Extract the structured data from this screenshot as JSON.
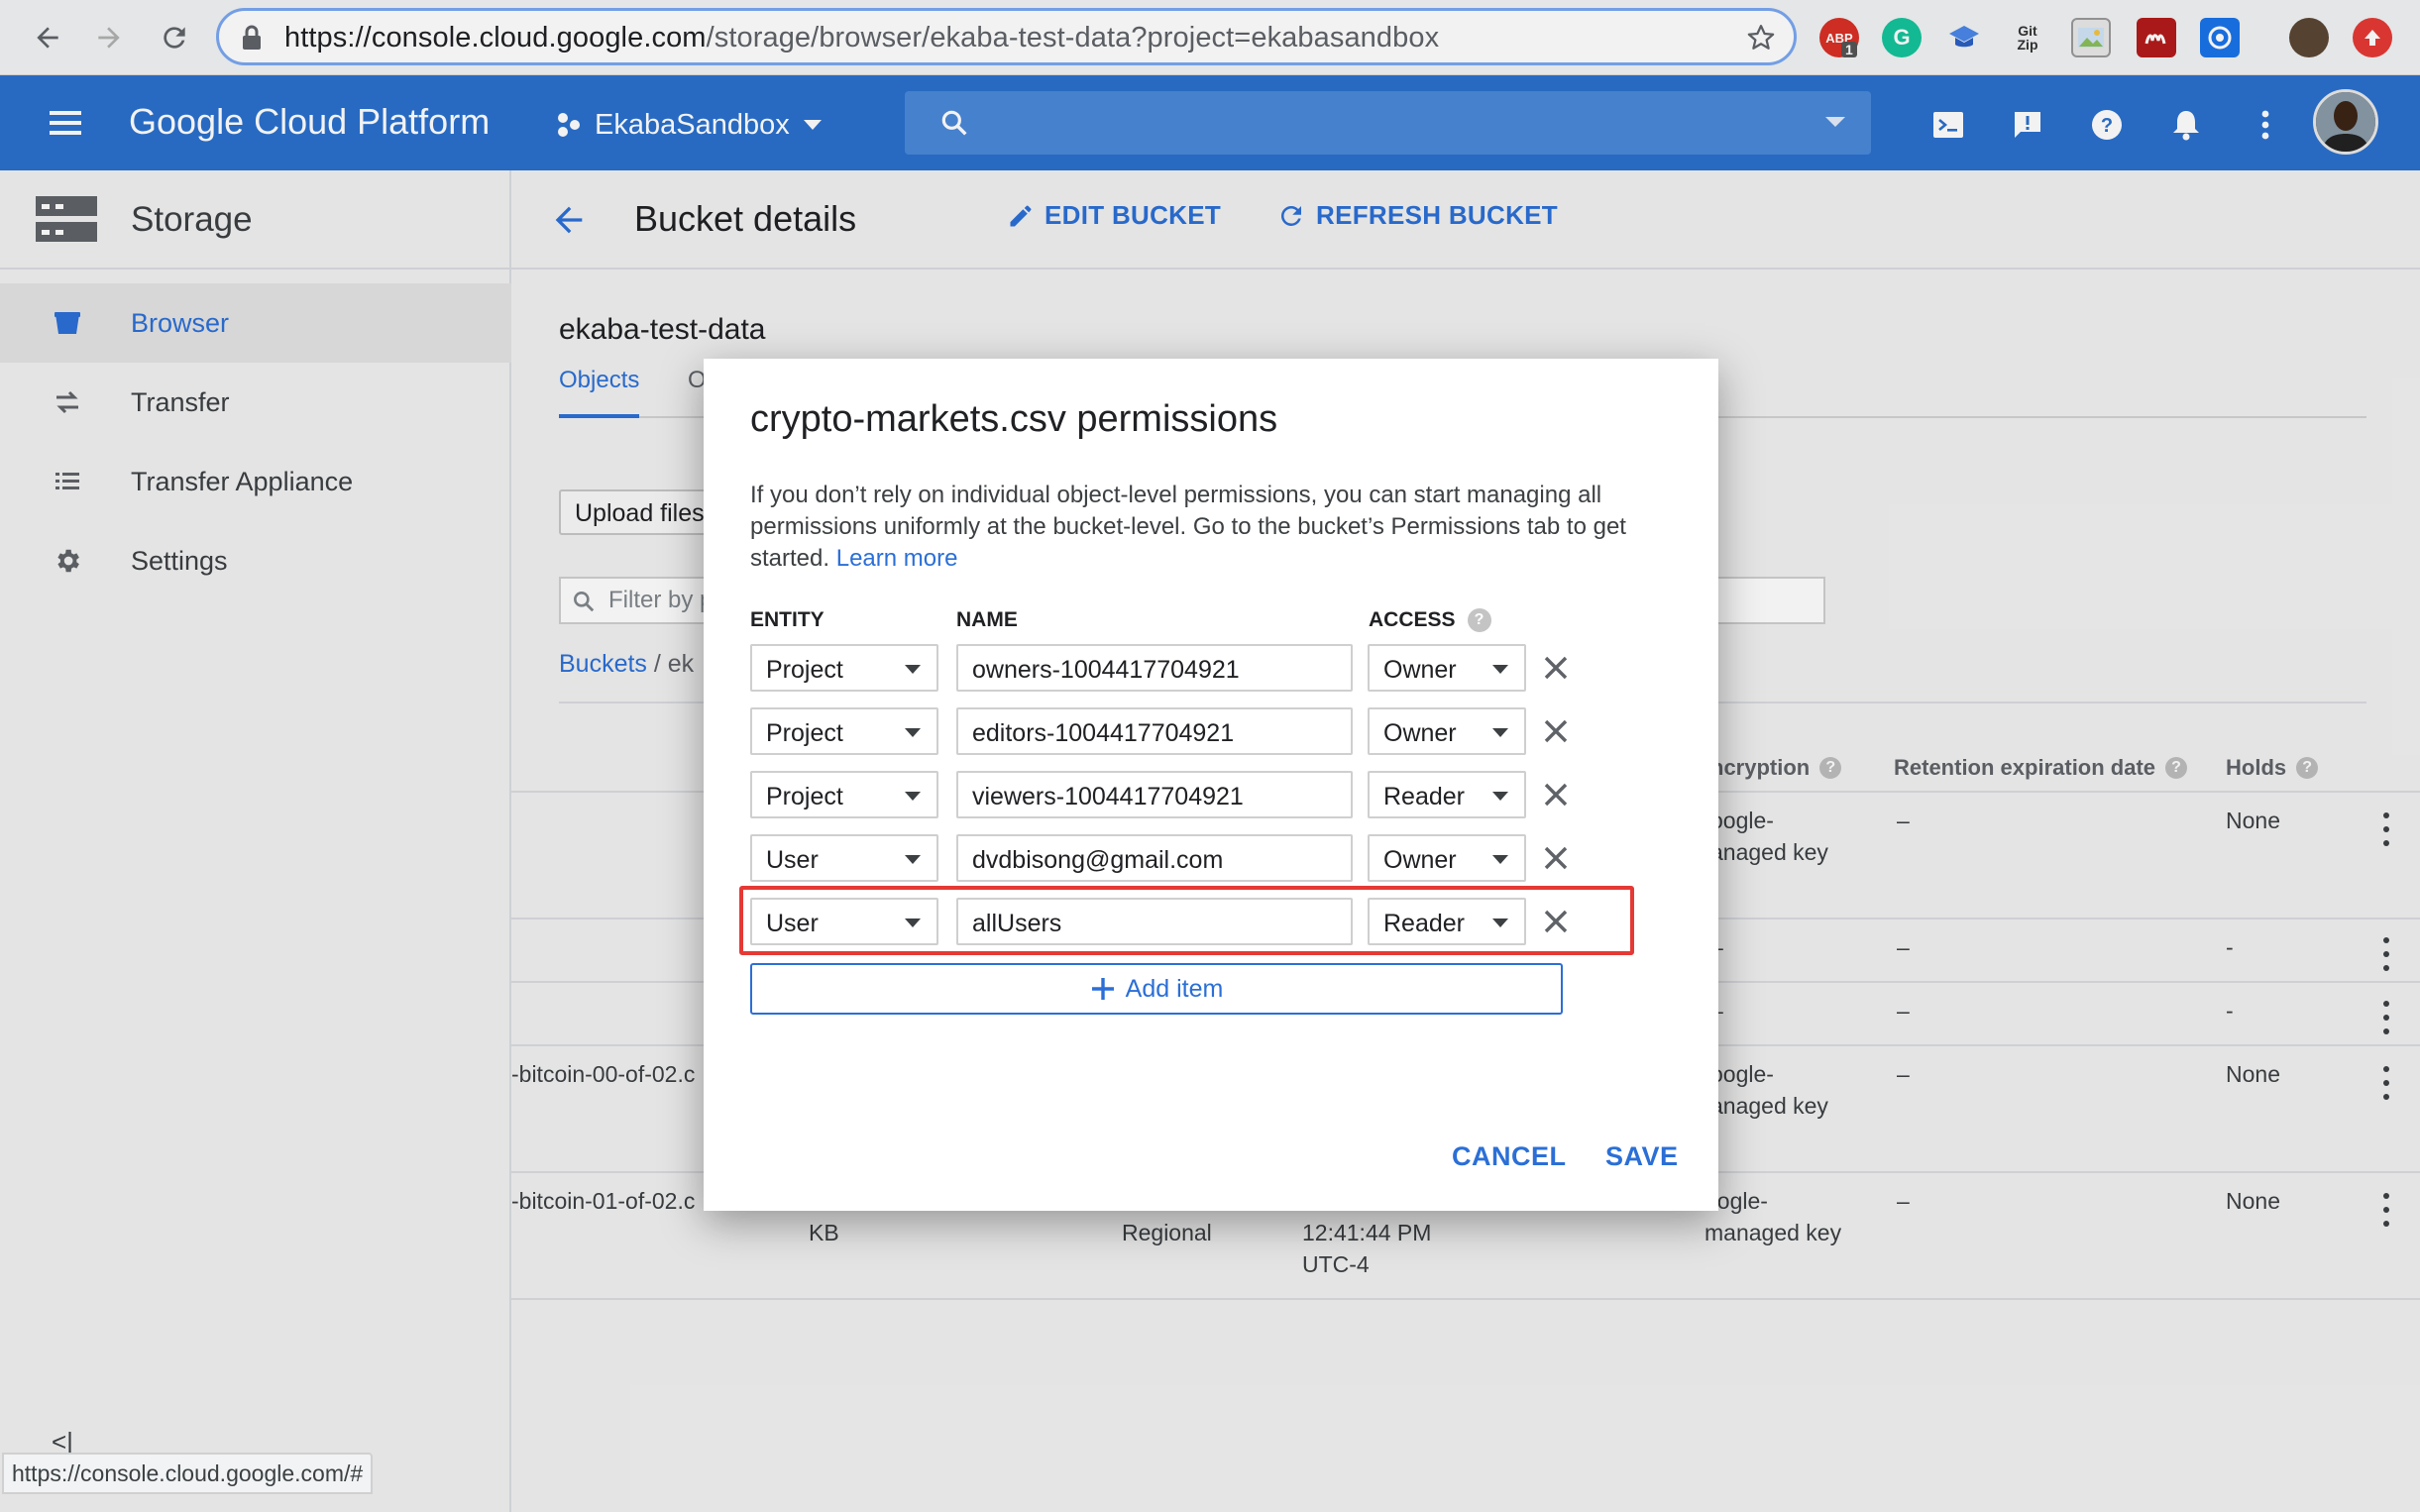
{
  "browser": {
    "url_main": "https://console.cloud.google.com",
    "url_path": "/storage/browser/ekaba-test-data?project=ekabasandbox",
    "extensions": [
      {
        "name": "adblock-icon",
        "label": "ABP",
        "badge": "1",
        "color": "#d93025"
      },
      {
        "name": "grammarly-icon",
        "label": "G",
        "color": "#15c39a"
      },
      {
        "name": "graduation-cap-icon",
        "label": "",
        "color": "#4a86e8"
      },
      {
        "name": "gitzip-icon",
        "label": "Git Zip",
        "color": "#ffffff"
      },
      {
        "name": "image-icon",
        "label": "",
        "color": "#e0e0e0"
      },
      {
        "name": "mendeley-icon",
        "label": "",
        "color": "#b31b1b"
      },
      {
        "name": "target-icon",
        "label": "",
        "color": "#1a73e8"
      },
      {
        "name": "profile-icon",
        "label": "",
        "color": "#5b4634"
      },
      {
        "name": "upload-icon",
        "label": "",
        "color": "#e53935"
      }
    ]
  },
  "gcp": {
    "title": "Google Cloud Platform",
    "project": "EkabaSandbox"
  },
  "sidebar": {
    "title": "Storage",
    "items": [
      {
        "label": "Browser",
        "icon": "bucket-icon",
        "active": true
      },
      {
        "label": "Transfer",
        "icon": "transfer-icon",
        "active": false
      },
      {
        "label": "Transfer Appliance",
        "icon": "list-icon",
        "active": false
      },
      {
        "label": "Settings",
        "icon": "gear-icon",
        "active": false
      }
    ],
    "collapse": "<|"
  },
  "main": {
    "title": "Bucket details",
    "edit_label": "EDIT BUCKET",
    "refresh_label": "REFRESH BUCKET",
    "bucket_name": "ekaba-test-data",
    "tabs": [
      "Objects",
      "O"
    ],
    "upload_label": "Upload files",
    "filter_placeholder": "Filter by p",
    "breadcrumb_link": "Buckets",
    "breadcrumb_rest": "/ ek",
    "columns": {
      "encryption": "ncryption",
      "retention": "Retention expiration date",
      "holds": "Holds"
    },
    "rows": [
      {
        "name": "",
        "encryption": "oogle-",
        "encryption2": "anaged key",
        "retention": "–",
        "holds": "None"
      },
      {
        "name": "",
        "encryption": "–",
        "encryption2": "",
        "retention": "–",
        "holds": "-"
      },
      {
        "name": "",
        "encryption": "–",
        "encryption2": "",
        "retention": "–",
        "holds": "-"
      },
      {
        "name": "-bitcoin-00-of-02.c",
        "encryption": "oogle-",
        "encryption2": "anaged key",
        "retention": "–",
        "holds": "None"
      },
      {
        "name": "-bitcoin-01-of-02.c",
        "size": "KB",
        "storage_class": "Regional",
        "time1": "12:41:44 PM",
        "time2": "UTC-4",
        "encryption": "oogle-",
        "encryption2": "managed key",
        "retention": "–",
        "holds": "None"
      }
    ]
  },
  "dialog": {
    "title": "crypto-markets.csv permissions",
    "description": "If you don’t rely on individual object-level permissions, you can start managing all permissions uniformly at the bucket-level. Go to the bucket’s Permissions tab to get started. ",
    "learn_more": "Learn more",
    "headers": {
      "entity": "ENTITY",
      "name": "NAME",
      "access": "ACCESS"
    },
    "rows": [
      {
        "entity": "Project",
        "name": "owners-1004417704921",
        "access": "Owner"
      },
      {
        "entity": "Project",
        "name": "editors-1004417704921",
        "access": "Owner"
      },
      {
        "entity": "Project",
        "name": "viewers-1004417704921",
        "access": "Reader"
      },
      {
        "entity": "User",
        "name": "dvdbisong@gmail.com",
        "access": "Owner"
      },
      {
        "entity": "User",
        "name": "allUsers",
        "access": "Reader"
      }
    ],
    "add_item": "Add item",
    "cancel": "CANCEL",
    "save": "SAVE"
  },
  "status_bar": "https://console.cloud.google.com/#",
  "colors": {
    "brand_blue": "#2b70cd",
    "link_blue": "#2b6fd6",
    "highlight_red": "#e53935"
  }
}
